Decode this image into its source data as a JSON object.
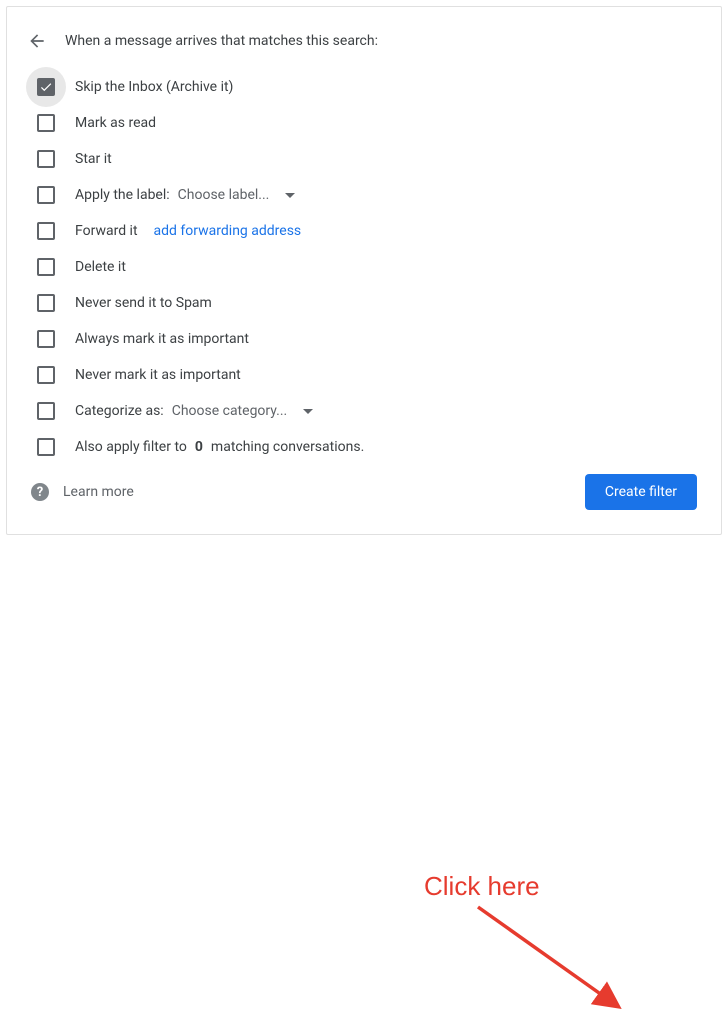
{
  "header": {
    "title": "When a message arrives that matches this search:"
  },
  "options": {
    "skip_inbox": "Skip the Inbox (Archive it)",
    "mark_read": "Mark as read",
    "star_it": "Star it",
    "apply_label": "Apply the label:",
    "apply_label_dropdown": "Choose label...",
    "forward_it": "Forward it",
    "forward_link": "add forwarding address",
    "delete_it": "Delete it",
    "never_spam": "Never send it to Spam",
    "always_important": "Always mark it as important",
    "never_important": "Never mark it as important",
    "categorize_as": "Categorize as:",
    "categorize_dropdown": "Choose category...",
    "also_apply_pre": "Also apply filter to ",
    "also_apply_count": "0",
    "also_apply_post": " matching conversations."
  },
  "footer": {
    "learn_more": "Learn more",
    "create_filter": "Create filter"
  },
  "annotation": {
    "text": "Click here"
  }
}
